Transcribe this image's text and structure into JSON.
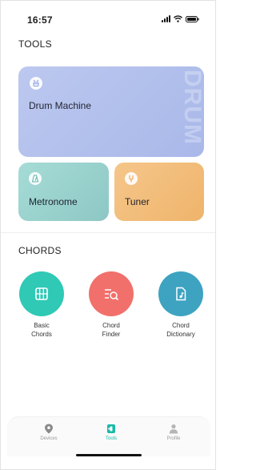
{
  "status_bar": {
    "time": "16:57",
    "icons": [
      "cellular-signal-icon",
      "wifi-icon",
      "battery-icon"
    ]
  },
  "tools": {
    "heading": "TOOLS",
    "drum_machine": {
      "label": "Drum Machine",
      "watermark": "DRUM",
      "icon": "drum-icon",
      "color": "#b2c0ec"
    },
    "metronome": {
      "label": "Metronome",
      "icon": "metronome-icon",
      "color": "#9ad2cd"
    },
    "tuner": {
      "label": "Tuner",
      "icon": "tuning-fork-icon",
      "color": "#f2bd7a"
    }
  },
  "chords": {
    "heading": "CHORDS",
    "items": [
      {
        "label_line1": "Basic",
        "label_line2": "Chords",
        "icon": "chord-grid-icon",
        "color": "#2fc9b6"
      },
      {
        "label_line1": "Chord",
        "label_line2": "Finder",
        "icon": "search-list-icon",
        "color": "#f1706b"
      },
      {
        "label_line1": "Chord",
        "label_line2": "Dictionary",
        "icon": "music-note-document-icon",
        "color": "#3da3c1"
      }
    ]
  },
  "tab_bar": {
    "active": "Tools",
    "accent_color": "#18b9a6",
    "items": [
      {
        "label": "Devices",
        "icon": "location-pin-icon"
      },
      {
        "label": "Tools",
        "icon": "toolbox-icon"
      },
      {
        "label": "Profile",
        "icon": "person-icon"
      }
    ]
  }
}
